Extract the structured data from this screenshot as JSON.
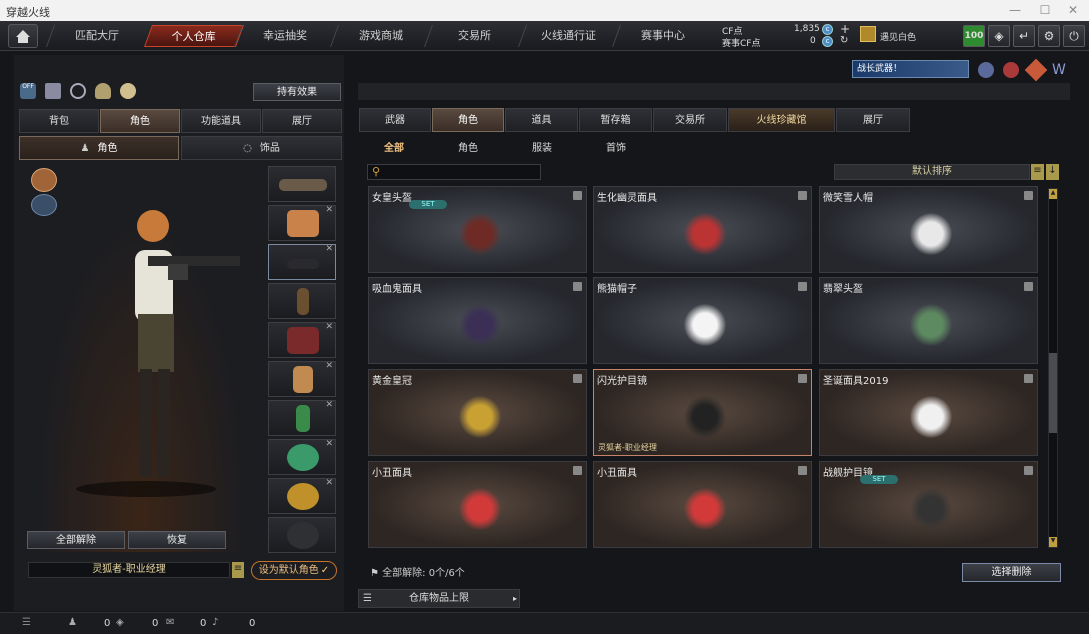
{
  "window": {
    "title": "穿越火线"
  },
  "nav": {
    "tabs": [
      "匹配大厅",
      "个人仓库",
      "幸运抽奖",
      "游戏商城",
      "交易所",
      "火线通行证",
      "赛事中心"
    ],
    "active": "个人仓库"
  },
  "currency": {
    "cf_label": "CF点",
    "cf_value": "1,835",
    "event_label": "赛事CF点",
    "event_value": "0",
    "user": "遇见白色",
    "level": "100"
  },
  "left": {
    "effects_button": "持有效果",
    "tabs": [
      "背包",
      "角色",
      "功能道具",
      "展厅"
    ],
    "active_tab": "角色",
    "subtabs": [
      "角色",
      "饰品"
    ],
    "unequip_all": "全部解除",
    "restore": "恢复",
    "character_name": "灵狐者-职业经理",
    "set_default": "设为默认角色"
  },
  "right": {
    "banner": "战长武器！",
    "tabs": [
      "武器",
      "角色",
      "道具",
      "暂存箱",
      "交易所",
      "火线珍藏馆",
      "展厅"
    ],
    "active_tab": "角色",
    "subtabs": [
      "全部",
      "角色",
      "服装",
      "首饰"
    ],
    "active_subtab": "全部",
    "sort_label": "默认排序",
    "items": [
      {
        "name": "女皇头盔",
        "set": "SET",
        "color": "#6e2a24"
      },
      {
        "name": "生化幽灵面具",
        "color": "#b33"
      },
      {
        "name": "微笑雪人帽",
        "color": "#e8e8e8"
      },
      {
        "name": "吸血鬼面具",
        "color": "#3b2f55"
      },
      {
        "name": "熊猫帽子",
        "color": "#f4f4f4"
      },
      {
        "name": "翡翠头盔",
        "color": "#5d8a60"
      },
      {
        "name": "黄金皇冠",
        "color": "#c9a133"
      },
      {
        "name": "闪光护目镜",
        "color": "#222",
        "sub": "灵狐者-职业经理"
      },
      {
        "name": "圣诞面具2019",
        "color": "#f0f0f0"
      },
      {
        "name": "小丑面具",
        "color": "#d23a3a"
      },
      {
        "name": "小丑面具",
        "color": "#d23a3a"
      },
      {
        "name": "战舰护目镜",
        "set": "SET",
        "color": "#333"
      }
    ],
    "release_label": "全部解除:",
    "release_count": "0个/6个",
    "select_delete": "选择删除",
    "storage_limit": "仓库物品上限"
  },
  "bottombar": {
    "counts": [
      "0",
      "0",
      "0",
      "0"
    ]
  }
}
